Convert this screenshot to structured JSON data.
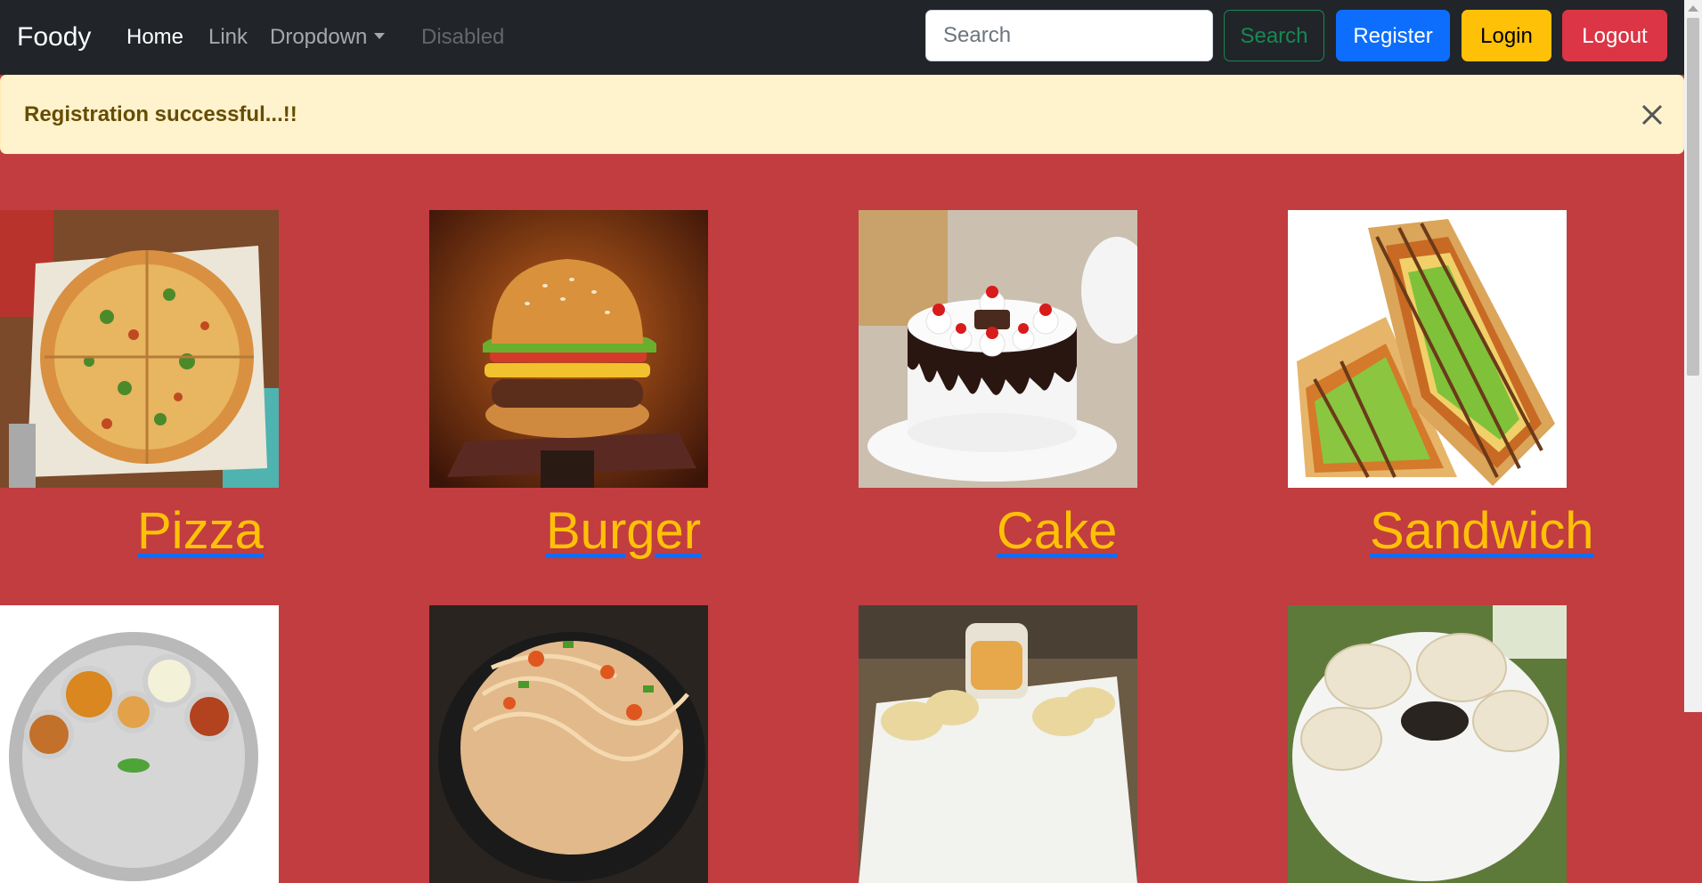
{
  "navbar": {
    "brand": "Foody",
    "links": [
      {
        "label": "Home",
        "state": "active"
      },
      {
        "label": "Link",
        "state": "normal"
      },
      {
        "label": "Dropdown",
        "state": "normal"
      },
      {
        "label": "Disabled",
        "state": "disabled"
      }
    ],
    "search_placeholder": "Search",
    "search_value": "",
    "buttons": {
      "search": "Search",
      "register": "Register",
      "login": "Login",
      "logout": "Logout"
    }
  },
  "alert": {
    "message": "Registration successful...!!"
  },
  "foods": [
    {
      "name": "Pizza",
      "image": "pizza-photo"
    },
    {
      "name": "Burger",
      "image": "burger-photo"
    },
    {
      "name": "Cake",
      "image": "cake-photo"
    },
    {
      "name": "Sandwich",
      "image": "sandwich-photo"
    },
    {
      "name": "",
      "image": "thali-photo"
    },
    {
      "name": "",
      "image": "noodles-photo"
    },
    {
      "name": "",
      "image": "chips-dip-photo"
    },
    {
      "name": "",
      "image": "momos-photo"
    }
  ],
  "colors": {
    "page_background": "#c13d40",
    "navbar_background": "#212529",
    "food_label": "#ffc107",
    "food_label_underline": "#0d6efd",
    "alert_background": "#fff3cd",
    "alert_text": "#664d03",
    "register": "#0d6efd",
    "login": "#ffc107",
    "logout": "#dc3545",
    "search_outline": "#198754"
  }
}
